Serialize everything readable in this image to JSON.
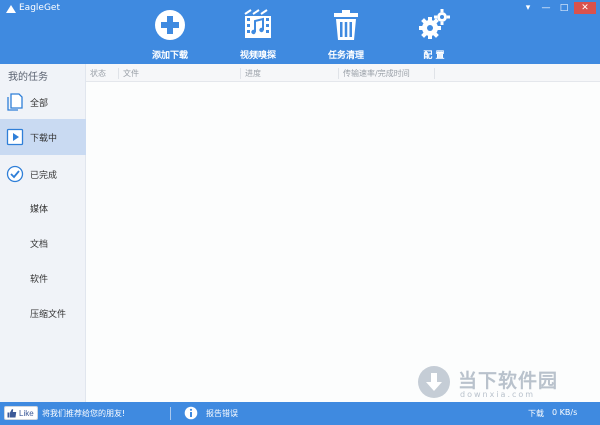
{
  "window": {
    "title": "EagleGet",
    "controls": {
      "dropdown": "▾",
      "minimize": "—",
      "maximize": "□",
      "close": "✕"
    }
  },
  "toolbar": {
    "items": [
      {
        "label": "添加下载",
        "icon": "plus-circle-icon"
      },
      {
        "label": "视频嗅探",
        "icon": "video-sniff-icon"
      },
      {
        "label": "任务清理",
        "icon": "trash-icon"
      },
      {
        "label": "配  置",
        "icon": "gear-icon"
      }
    ]
  },
  "sidebar": {
    "title": "我的任务",
    "items": [
      {
        "label": "全部",
        "icon": "document-icon"
      },
      {
        "label": "下载中",
        "icon": "play-icon",
        "active": true
      },
      {
        "label": "已完成",
        "icon": "check-circle-icon"
      }
    ],
    "categories": [
      {
        "label": "媒体"
      },
      {
        "label": "文档"
      },
      {
        "label": "软件"
      },
      {
        "label": "压缩文件"
      }
    ]
  },
  "table": {
    "columns": [
      "状态",
      "文件",
      "进度",
      "传输速率/完成时间"
    ]
  },
  "watermark": {
    "text": "当下软件园",
    "url": "downxia.com"
  },
  "statusbar": {
    "like_label": "Like",
    "recommend": "将我们推荐给您的朋友!",
    "report": "报告错误",
    "download_label": "下载",
    "download_speed": "0 KB/s"
  },
  "colors": {
    "primary": "#3f8ae0",
    "sidebar_bg": "#f0f3f8",
    "active_item": "#c9daf2",
    "icon_blue": "#2f7fd8"
  }
}
